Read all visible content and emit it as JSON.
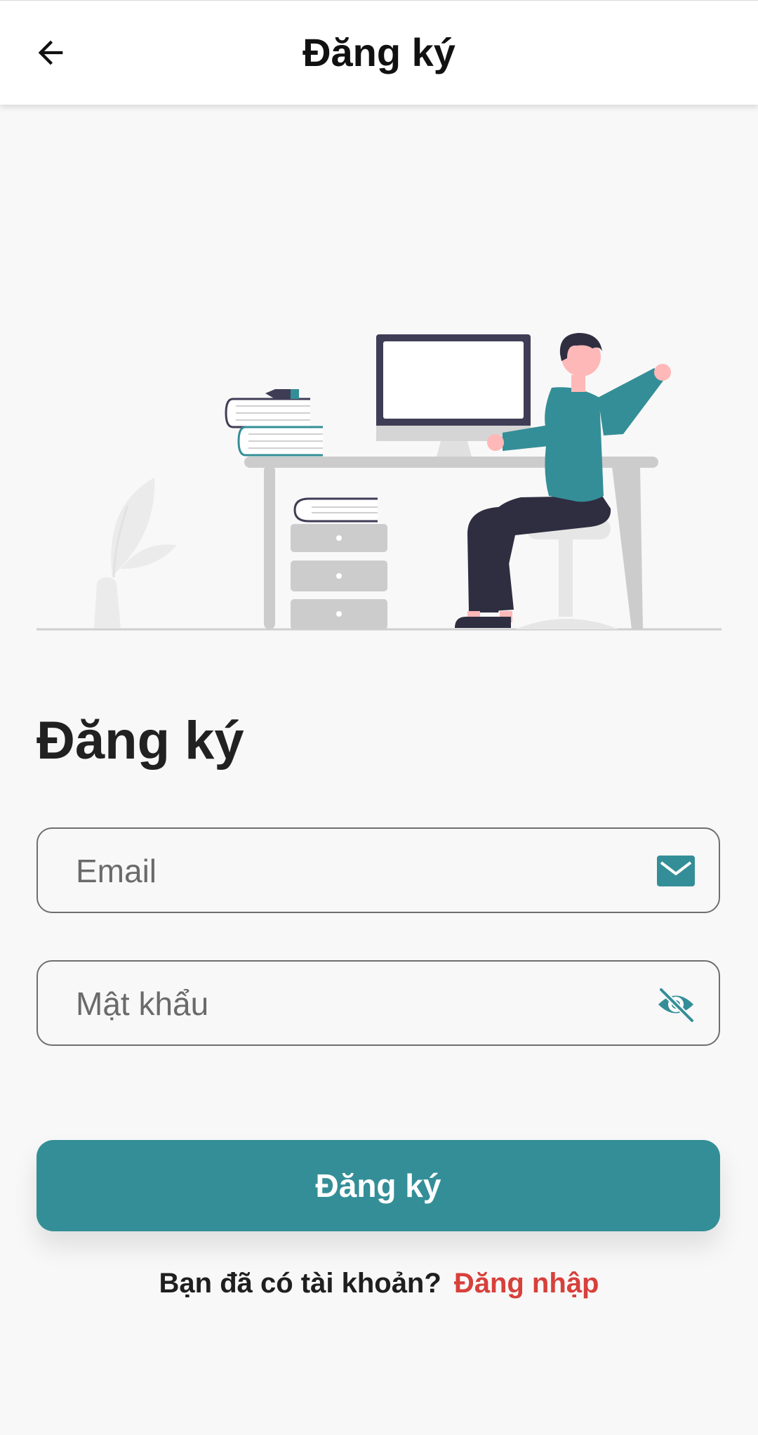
{
  "appbar": {
    "title": "Đăng ký",
    "back_icon": "arrow-left-icon"
  },
  "page": {
    "heading": "Đăng ký"
  },
  "form": {
    "email": {
      "placeholder": "Email",
      "value": "",
      "icon": "envelope-icon"
    },
    "password": {
      "placeholder": "Mật khẩu",
      "value": "",
      "icon": "eye-off-icon"
    },
    "submit_label": "Đăng ký"
  },
  "footer": {
    "prompt": "Bạn đã có tài khoản?",
    "link_label": "Đăng nhập"
  },
  "colors": {
    "primary": "#348e97",
    "link": "#d8403b",
    "background": "#f8f8f8",
    "illustration_dark": "#3f3d56",
    "skin": "#ffb8b8"
  }
}
